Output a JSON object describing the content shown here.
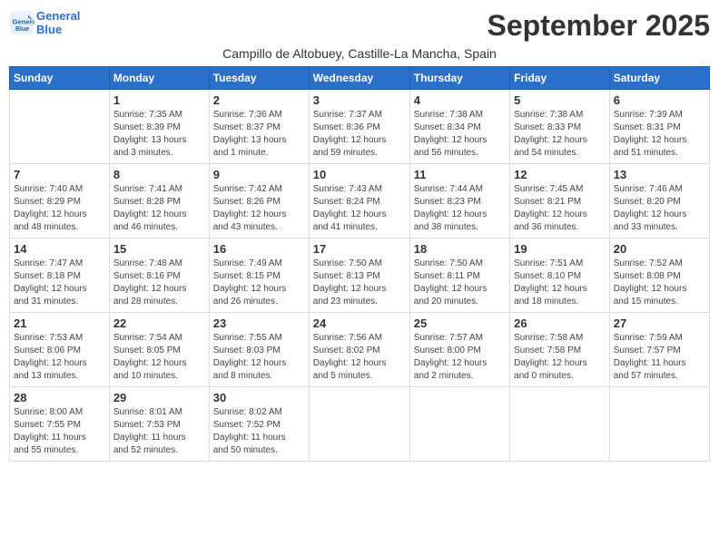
{
  "header": {
    "logo_line1": "General",
    "logo_line2": "Blue",
    "month_title": "September 2025",
    "location": "Campillo de Altobuey, Castille-La Mancha, Spain"
  },
  "days_of_week": [
    "Sunday",
    "Monday",
    "Tuesday",
    "Wednesday",
    "Thursday",
    "Friday",
    "Saturday"
  ],
  "weeks": [
    [
      {
        "day": "",
        "info": ""
      },
      {
        "day": "1",
        "info": "Sunrise: 7:35 AM\nSunset: 8:39 PM\nDaylight: 13 hours\nand 3 minutes."
      },
      {
        "day": "2",
        "info": "Sunrise: 7:36 AM\nSunset: 8:37 PM\nDaylight: 13 hours\nand 1 minute."
      },
      {
        "day": "3",
        "info": "Sunrise: 7:37 AM\nSunset: 8:36 PM\nDaylight: 12 hours\nand 59 minutes."
      },
      {
        "day": "4",
        "info": "Sunrise: 7:38 AM\nSunset: 8:34 PM\nDaylight: 12 hours\nand 56 minutes."
      },
      {
        "day": "5",
        "info": "Sunrise: 7:38 AM\nSunset: 8:33 PM\nDaylight: 12 hours\nand 54 minutes."
      },
      {
        "day": "6",
        "info": "Sunrise: 7:39 AM\nSunset: 8:31 PM\nDaylight: 12 hours\nand 51 minutes."
      }
    ],
    [
      {
        "day": "7",
        "info": "Sunrise: 7:40 AM\nSunset: 8:29 PM\nDaylight: 12 hours\nand 48 minutes."
      },
      {
        "day": "8",
        "info": "Sunrise: 7:41 AM\nSunset: 8:28 PM\nDaylight: 12 hours\nand 46 minutes."
      },
      {
        "day": "9",
        "info": "Sunrise: 7:42 AM\nSunset: 8:26 PM\nDaylight: 12 hours\nand 43 minutes."
      },
      {
        "day": "10",
        "info": "Sunrise: 7:43 AM\nSunset: 8:24 PM\nDaylight: 12 hours\nand 41 minutes."
      },
      {
        "day": "11",
        "info": "Sunrise: 7:44 AM\nSunset: 8:23 PM\nDaylight: 12 hours\nand 38 minutes."
      },
      {
        "day": "12",
        "info": "Sunrise: 7:45 AM\nSunset: 8:21 PM\nDaylight: 12 hours\nand 36 minutes."
      },
      {
        "day": "13",
        "info": "Sunrise: 7:46 AM\nSunset: 8:20 PM\nDaylight: 12 hours\nand 33 minutes."
      }
    ],
    [
      {
        "day": "14",
        "info": "Sunrise: 7:47 AM\nSunset: 8:18 PM\nDaylight: 12 hours\nand 31 minutes."
      },
      {
        "day": "15",
        "info": "Sunrise: 7:48 AM\nSunset: 8:16 PM\nDaylight: 12 hours\nand 28 minutes."
      },
      {
        "day": "16",
        "info": "Sunrise: 7:49 AM\nSunset: 8:15 PM\nDaylight: 12 hours\nand 26 minutes."
      },
      {
        "day": "17",
        "info": "Sunrise: 7:50 AM\nSunset: 8:13 PM\nDaylight: 12 hours\nand 23 minutes."
      },
      {
        "day": "18",
        "info": "Sunrise: 7:50 AM\nSunset: 8:11 PM\nDaylight: 12 hours\nand 20 minutes."
      },
      {
        "day": "19",
        "info": "Sunrise: 7:51 AM\nSunset: 8:10 PM\nDaylight: 12 hours\nand 18 minutes."
      },
      {
        "day": "20",
        "info": "Sunrise: 7:52 AM\nSunset: 8:08 PM\nDaylight: 12 hours\nand 15 minutes."
      }
    ],
    [
      {
        "day": "21",
        "info": "Sunrise: 7:53 AM\nSunset: 8:06 PM\nDaylight: 12 hours\nand 13 minutes."
      },
      {
        "day": "22",
        "info": "Sunrise: 7:54 AM\nSunset: 8:05 PM\nDaylight: 12 hours\nand 10 minutes."
      },
      {
        "day": "23",
        "info": "Sunrise: 7:55 AM\nSunset: 8:03 PM\nDaylight: 12 hours\nand 8 minutes."
      },
      {
        "day": "24",
        "info": "Sunrise: 7:56 AM\nSunset: 8:02 PM\nDaylight: 12 hours\nand 5 minutes."
      },
      {
        "day": "25",
        "info": "Sunrise: 7:57 AM\nSunset: 8:00 PM\nDaylight: 12 hours\nand 2 minutes."
      },
      {
        "day": "26",
        "info": "Sunrise: 7:58 AM\nSunset: 7:58 PM\nDaylight: 12 hours\nand 0 minutes."
      },
      {
        "day": "27",
        "info": "Sunrise: 7:59 AM\nSunset: 7:57 PM\nDaylight: 11 hours\nand 57 minutes."
      }
    ],
    [
      {
        "day": "28",
        "info": "Sunrise: 8:00 AM\nSunset: 7:55 PM\nDaylight: 11 hours\nand 55 minutes."
      },
      {
        "day": "29",
        "info": "Sunrise: 8:01 AM\nSunset: 7:53 PM\nDaylight: 11 hours\nand 52 minutes."
      },
      {
        "day": "30",
        "info": "Sunrise: 8:02 AM\nSunset: 7:52 PM\nDaylight: 11 hours\nand 50 minutes."
      },
      {
        "day": "",
        "info": ""
      },
      {
        "day": "",
        "info": ""
      },
      {
        "day": "",
        "info": ""
      },
      {
        "day": "",
        "info": ""
      }
    ]
  ]
}
